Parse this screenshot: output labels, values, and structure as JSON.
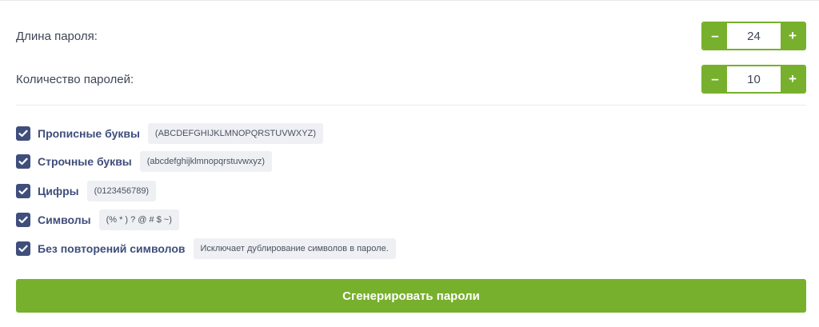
{
  "settings": {
    "length": {
      "label": "Длина пароля:",
      "value": "24",
      "minus": "–",
      "plus": "+"
    },
    "count": {
      "label": "Количество паролей:",
      "value": "10",
      "minus": "–",
      "plus": "+"
    }
  },
  "options": [
    {
      "label": "Прописные буквы",
      "hint": "(ABCDEFGHIJKLMNOPQRSTUVWXYZ)",
      "checked": true
    },
    {
      "label": "Строчные буквы",
      "hint": "(abcdefghijklmnopqrstuvwxyz)",
      "checked": true
    },
    {
      "label": "Цифры",
      "hint": "(0123456789)",
      "checked": true
    },
    {
      "label": "Символы",
      "hint": "(% * ) ? @ # $ ~)",
      "checked": true
    },
    {
      "label": "Без повторений символов",
      "hint": "Исключает дублирование символов в пароле.",
      "checked": true
    }
  ],
  "generate_button": {
    "label": "Сгенерировать пароли"
  },
  "colors": {
    "accent": "#77b02c",
    "checkbox": "#3f4e7b",
    "text": "#3e4655",
    "tag_bg": "#eef0f4"
  },
  "icons": {
    "checkbox_checked": "checkmark-icon"
  }
}
